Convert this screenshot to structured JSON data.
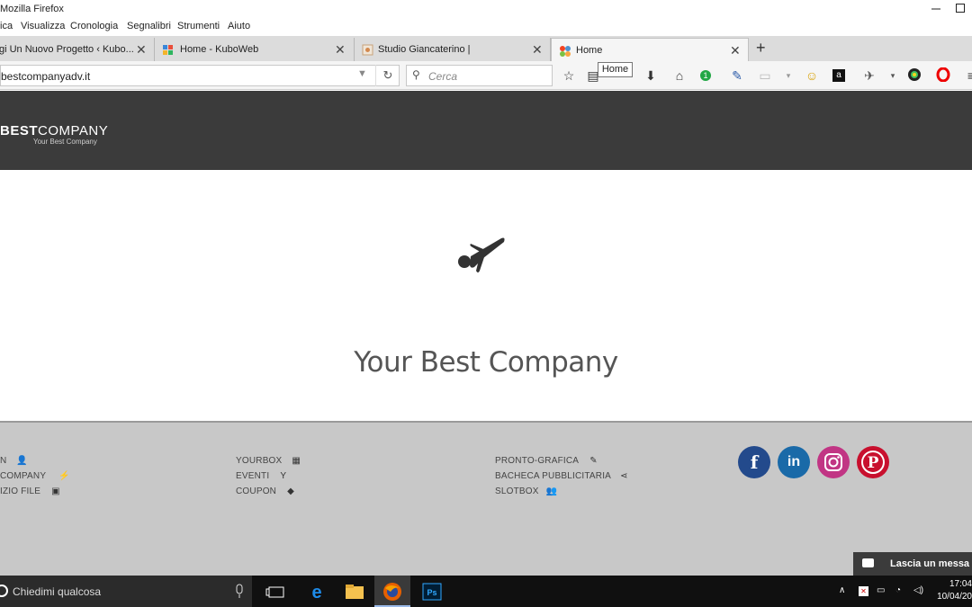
{
  "window": {
    "title": "Mozilla Firefox"
  },
  "menu": [
    "ica",
    "Visualizza",
    "Cronologia",
    "Segnalibri",
    "Strumenti",
    "Aiuto"
  ],
  "tabs": [
    {
      "label": "gi Un Nuovo Progetto ‹ Kubo...",
      "active": false
    },
    {
      "label": "Home - KuboWeb",
      "active": false
    },
    {
      "label": "Studio Giancaterino |",
      "active": false
    },
    {
      "label": "Home",
      "active": true
    }
  ],
  "navbar": {
    "url": "bestcompanyadv.it",
    "search_placeholder": "Cerca",
    "tooltip": "Home"
  },
  "site": {
    "logo_main": "BESTCOMPANY",
    "logo_main_bold": "BEST",
    "logo_main_rest": "COMPANY",
    "logo_sub": "Your Best Company",
    "hero_title": "Your Best Company",
    "footer_col1": [
      "N",
      "COMPANY",
      "IZIO FILE"
    ],
    "footer_col2": [
      "YOURBOX",
      "EVENTI",
      "COUPON"
    ],
    "footer_col3": [
      "PRONTO-GRAFICA",
      "BACHECA PUBBLICITARIA",
      "SLOTBOX"
    ],
    "social": [
      "f",
      "in",
      "instagram",
      "P"
    ],
    "chat_label": "Lascia un messa"
  },
  "taskbar": {
    "search_placeholder": "Chiedimi qualcosa",
    "time": "17:04",
    "date": "10/04/20"
  },
  "colors": {
    "header_bg": "#3b3b3b",
    "footer_bg": "#c8c8c8",
    "facebook": "#234a8c",
    "linkedin": "#1a6aa8",
    "instagram": "#c13584",
    "pinterest": "#c8102e"
  }
}
